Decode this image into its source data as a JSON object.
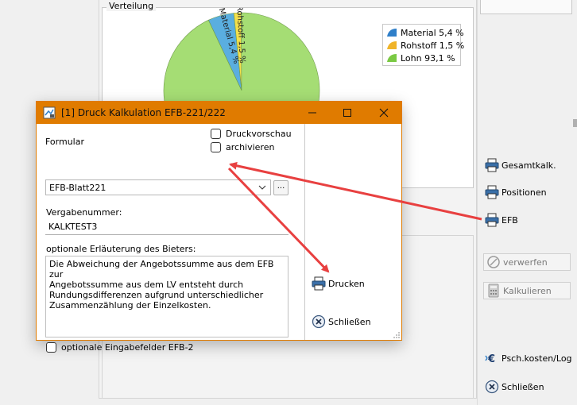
{
  "background": {
    "group_title": "Verteilung",
    "chart_data": {
      "type": "pie",
      "title": "",
      "categories": [
        "Material",
        "Rohstoff",
        "Lohn"
      ],
      "values": [
        5.4,
        1.5,
        93.1
      ],
      "colors": [
        "#5aaee0",
        "#f4e04c",
        "#a5dd74"
      ],
      "slice_labels": [
        "Material 5,4 %",
        "Rohstoff 1,5 %"
      ],
      "legend": {
        "placement": "top-right",
        "entries": [
          {
            "label": "Material 5,4 %",
            "color": "#2f7fc9"
          },
          {
            "label": "Rohstoff 1,5 %",
            "color": "#f0b429"
          },
          {
            "label": "Lohn 93,1 %",
            "color": "#7ac943"
          }
        ]
      }
    },
    "side_buttons": {
      "gesamtkalk": {
        "label": "Gesamtkalk.",
        "icon": "printer-icon"
      },
      "positionen": {
        "label": "Positionen",
        "icon": "printer-icon"
      },
      "efb": {
        "label": "EFB",
        "icon": "printer-icon"
      },
      "verwerfen": {
        "label": "verwerfen",
        "icon": "discard-icon"
      },
      "kalkulieren": {
        "label": "Kalkulieren",
        "icon": "calculator-icon"
      },
      "psch": {
        "label": "Psch.kosten/Log",
        "icon": "euro-icon"
      },
      "schliessen": {
        "label": "Schließen",
        "icon": "close-circle-icon"
      }
    }
  },
  "dialog": {
    "title": "[1] Druck Kalkulation EFB-221/222",
    "formular_label": "Formular",
    "druckvorschau_label": "Druckvorschau",
    "druckvorschau_checked": false,
    "archivieren_label": "archivieren",
    "archivieren_checked": false,
    "formular_value": "EFB-Blatt221",
    "dots_label": "...",
    "vergabenummer_label": "Vergabenummer:",
    "vergabenummer_value": "KALKTEST3",
    "erlaeuterung_label": "optionale Erläuterung des Bieters:",
    "erlaeuterung_lines": [
      "Die Abweichung der Angebotssumme aus dem EFB zur",
      "Angebotssumme aus dem LV entsteht durch",
      "Rundungsdifferenzen aufgrund unterschiedlicher",
      "Zusammenzählung der Einzelkosten."
    ],
    "optionale_label": "optionale  Eingabefelder  EFB-2",
    "optionale_checked": false,
    "drucken_label": "Drucken",
    "schliessen_label": "Schließen",
    "accent_color": "#e07b00"
  },
  "annotation_color": "#e84040"
}
